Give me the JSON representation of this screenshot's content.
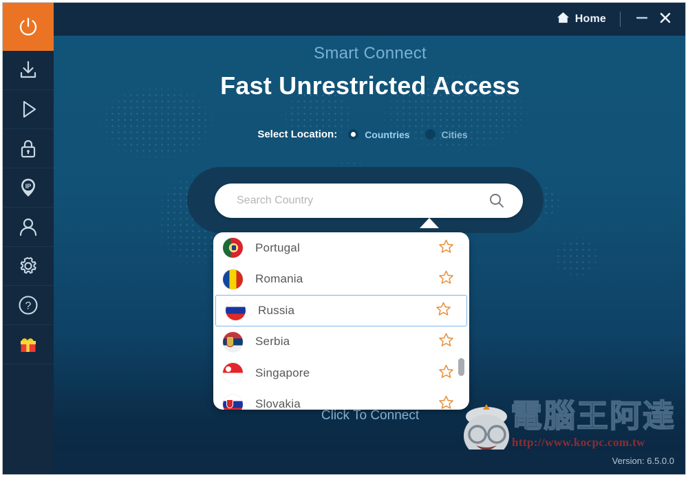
{
  "app": {
    "version_label": "Version: 6.5.0.0"
  },
  "titlebar": {
    "home_label": "Home",
    "home_icon": "home-icon",
    "minimize_icon": "minimize-icon",
    "close_icon": "close-icon"
  },
  "sidebar": {
    "items": [
      {
        "icon": "power-icon",
        "name": "power"
      },
      {
        "icon": "download-icon",
        "name": "download"
      },
      {
        "icon": "play-icon",
        "name": "play"
      },
      {
        "icon": "lock-icon",
        "name": "lock"
      },
      {
        "icon": "ip-pin-icon",
        "name": "ip"
      },
      {
        "icon": "user-icon",
        "name": "account"
      },
      {
        "icon": "gear-icon",
        "name": "settings"
      },
      {
        "icon": "help-icon",
        "name": "help"
      },
      {
        "icon": "gift-icon",
        "name": "gift"
      }
    ]
  },
  "main": {
    "subtitle": "Smart Connect",
    "headline": "Fast Unrestricted Access",
    "select_location_label": "Select Location:",
    "modes": [
      {
        "label": "Countries",
        "selected": true
      },
      {
        "label": "Cities",
        "selected": false
      }
    ],
    "connect_label": "Click To Connect"
  },
  "search": {
    "value": "",
    "placeholder": "Search Country",
    "icon": "search-icon"
  },
  "dropdown": {
    "rows": [
      {
        "country": "Portugal",
        "flag": "f-pt",
        "selected": false,
        "star": "star-icon"
      },
      {
        "country": "Romania",
        "flag": "f-ro",
        "selected": false,
        "star": "star-icon"
      },
      {
        "country": "Russia",
        "flag": "f-ru",
        "selected": true,
        "star": "star-icon"
      },
      {
        "country": "Serbia",
        "flag": "f-rs",
        "selected": false,
        "star": "star-icon"
      },
      {
        "country": "Singapore",
        "flag": "f-sg",
        "selected": false,
        "star": "star-icon"
      },
      {
        "country": "Slovakia",
        "flag": "f-sk",
        "selected": false,
        "star": "star-icon"
      }
    ]
  },
  "watermark": {
    "text": "電腦王阿達",
    "url": "http://www.kocpc.com.tw"
  },
  "colors": {
    "accent_orange": "#ea7424",
    "star_orange": "#e8903a",
    "panel_blue": "#12557a",
    "sidebar_navy": "#12293f",
    "titlebar_navy": "#112b44",
    "subtitle_blue": "#79b0d8",
    "selected_border": "#7fb4e3"
  }
}
